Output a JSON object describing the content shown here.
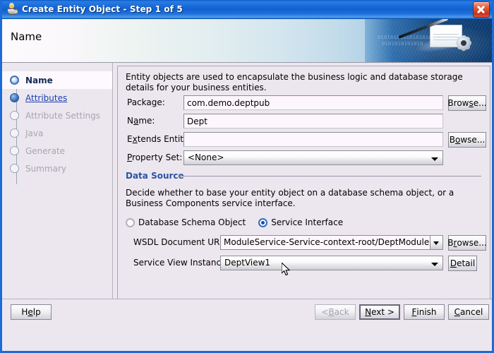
{
  "window": {
    "title": "Create Entity Object - Step 1 of 5",
    "icon": "java-coffee-cup-icon",
    "close_label": "",
    "accent_blue": "#1c6bd6",
    "panel_bg": "#ece7ee"
  },
  "banner": {
    "title": "Name",
    "binary_art_line1": "0101010101010101010101010101",
    "binary_art_line2": "0101010101010"
  },
  "sidebar": {
    "steps": [
      {
        "label": "Name",
        "state": "active"
      },
      {
        "label": "Attributes",
        "state": "link"
      },
      {
        "label": "Attribute Settings",
        "state": "disabled"
      },
      {
        "label": "Java",
        "state": "disabled"
      },
      {
        "label": "Generate",
        "state": "disabled"
      },
      {
        "label": "Summary",
        "state": "disabled"
      }
    ]
  },
  "main": {
    "intro": "Entity objects are used to encapsulate the business logic and database storage details for your business entities.",
    "fields": {
      "package": {
        "label_pre": "Packa",
        "label_mn": "g",
        "label_post": "e:",
        "value": "com.demo.deptpub",
        "browse": "Browse...",
        "browse_mn": "s"
      },
      "name": {
        "label_pre": "N",
        "label_mn": "a",
        "label_post": "me:",
        "value": "Dept"
      },
      "extends": {
        "label_pre": "E",
        "label_mn": "x",
        "label_post": "tends Entity:",
        "value": "",
        "browse": "Browse...",
        "browse_mn": "o"
      },
      "propset": {
        "label_pre": "",
        "label_mn": "P",
        "label_post": "roperty Set:",
        "value": "<None>"
      }
    },
    "data_source": {
      "title": "Data Source",
      "description": "Decide whether to base your entity object on a database schema object, or a Business Components service interface.",
      "radios": [
        {
          "label": "Database Schema Object",
          "selected": false
        },
        {
          "label": "Service Interface",
          "selected": true
        }
      ],
      "wsdl": {
        "label": "WSDL Document URL:",
        "value": "ModuleService-Service-context-root/DeptModuleService?WSDL",
        "browse": "Browse...",
        "browse_mn": "r"
      },
      "view_instance": {
        "label": "Service View Instance:",
        "value": "DeptView1",
        "detail_pre": "",
        "detail_mn": "D",
        "detail_post": "etail"
      }
    }
  },
  "footer": {
    "help": {
      "pre": "H",
      "mn": "e",
      "post": "lp"
    },
    "back": {
      "pre": "< ",
      "mn": "B",
      "post": "ack",
      "disabled": true
    },
    "next": {
      "pre": "",
      "mn": "N",
      "post": "ext >",
      "default": true
    },
    "finish": {
      "pre": "",
      "mn": "F",
      "post": "inish"
    },
    "cancel": {
      "pre": "",
      "mn": "C",
      "post": "ancel"
    }
  }
}
